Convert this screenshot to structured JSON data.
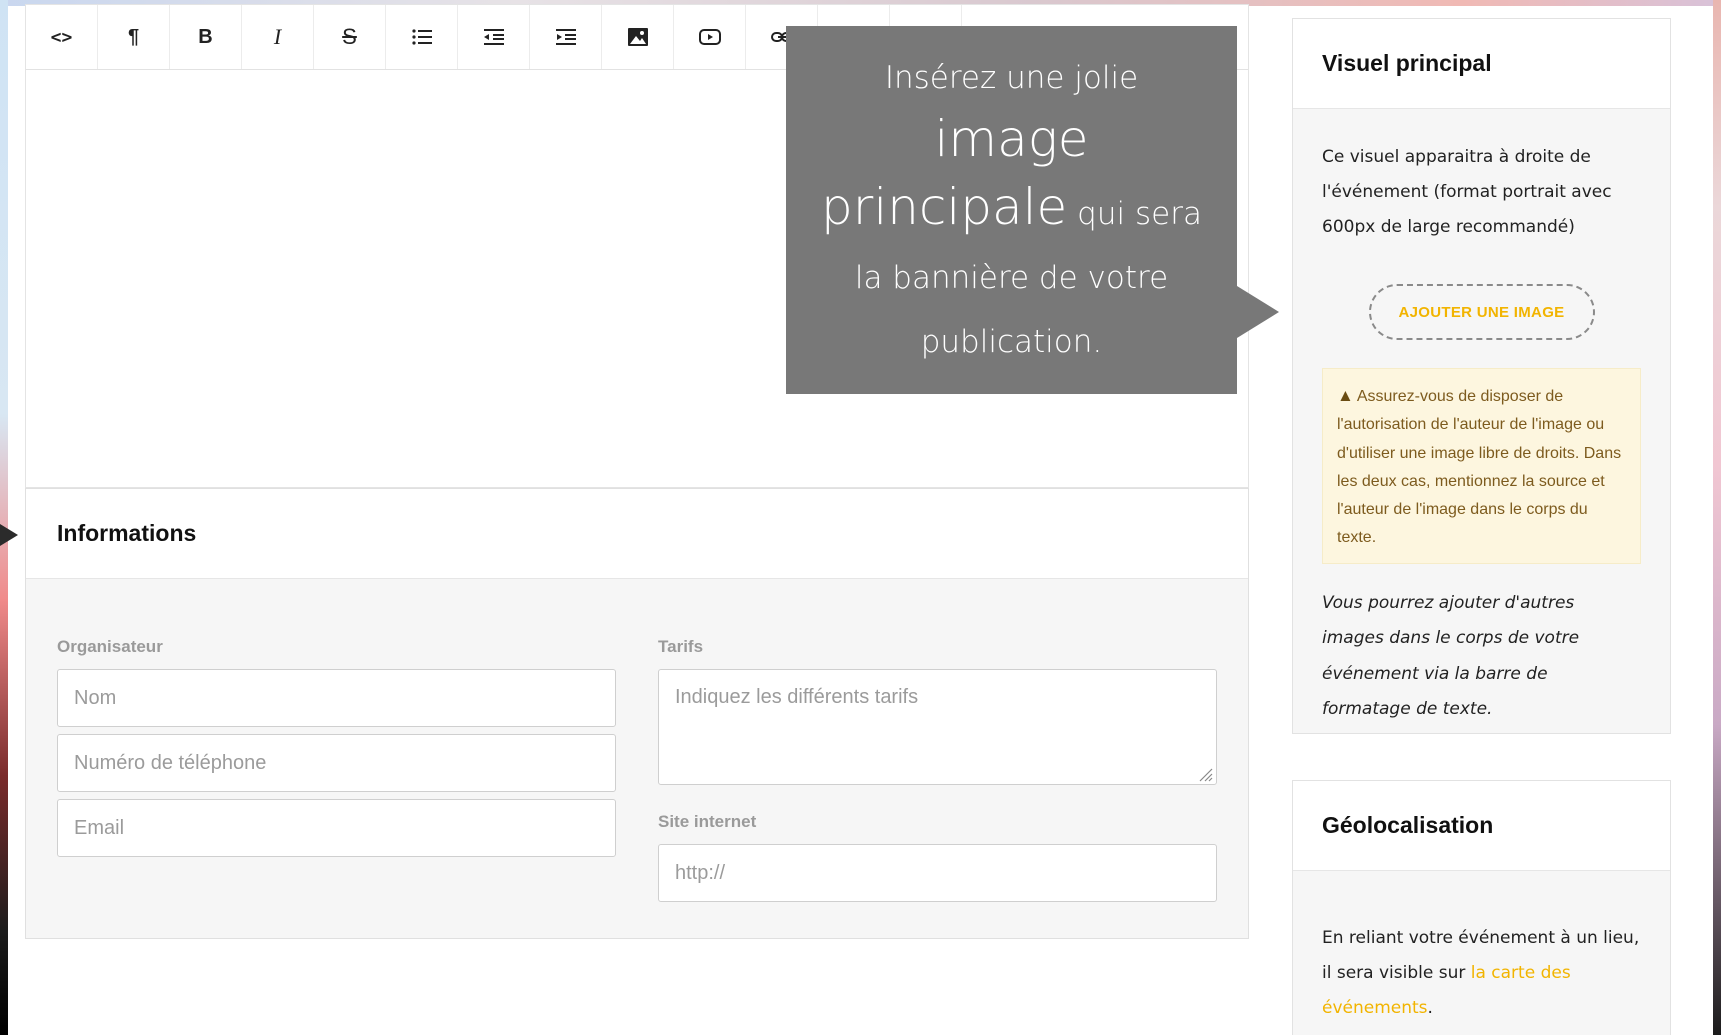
{
  "toolbar": {
    "items": [
      {
        "name": "code",
        "glyph": "<>"
      },
      {
        "name": "paragraph",
        "glyph": "¶"
      },
      {
        "name": "bold",
        "glyph": "B"
      },
      {
        "name": "italic",
        "glyph": "I"
      },
      {
        "name": "strikethrough",
        "glyph": "S"
      },
      {
        "name": "bullet-list",
        "glyph": "≔"
      },
      {
        "name": "outdent",
        "glyph": "⇤"
      },
      {
        "name": "indent",
        "glyph": "⇥"
      },
      {
        "name": "image",
        "glyph": "▣"
      },
      {
        "name": "video",
        "glyph": "▶"
      },
      {
        "name": "link",
        "glyph": "🔗"
      },
      {
        "name": "horizontal-rule",
        "glyph": "—"
      },
      {
        "name": "align",
        "glyph": "≡"
      }
    ]
  },
  "tooltip": {
    "part1": "Insérez une jolie ",
    "part2": "image principale",
    "part3": " qui sera la bannière de votre publication."
  },
  "informations": {
    "title": "Informations",
    "organizer_label": "Organisateur",
    "name_placeholder": "Nom",
    "phone_placeholder": "Numéro de téléphone",
    "email_placeholder": "Email",
    "tarifs_label": "Tarifs",
    "tarifs_placeholder": "Indiquez les différents tarifs",
    "website_label": "Site internet",
    "website_placeholder": "http://"
  },
  "visuel": {
    "title": "Visuel principal",
    "description": "Ce visuel apparaitra à droite de l'événement (format portrait avec 600px de large recommandé)",
    "button": "AJOUTER UNE IMAGE",
    "warning": "Assurez-vous de disposer de l'autorisation de l'auteur de l'image ou d'utiliser une image libre de droits. Dans les deux cas, mentionnez la source et l'auteur de l'image dans le corps du texte.",
    "note": "Vous pourrez ajouter d'autres images dans le corps de votre événement via la barre de formatage de texte."
  },
  "geo": {
    "title": "Géolocalisation",
    "text_before": "En reliant votre événement à un lieu, il sera visible sur ",
    "link": "la carte des événements",
    "text_after": "."
  },
  "colors": {
    "accent": "#f2b400",
    "tooltip_bg": "#787878",
    "warning_bg": "#fdf6df"
  }
}
